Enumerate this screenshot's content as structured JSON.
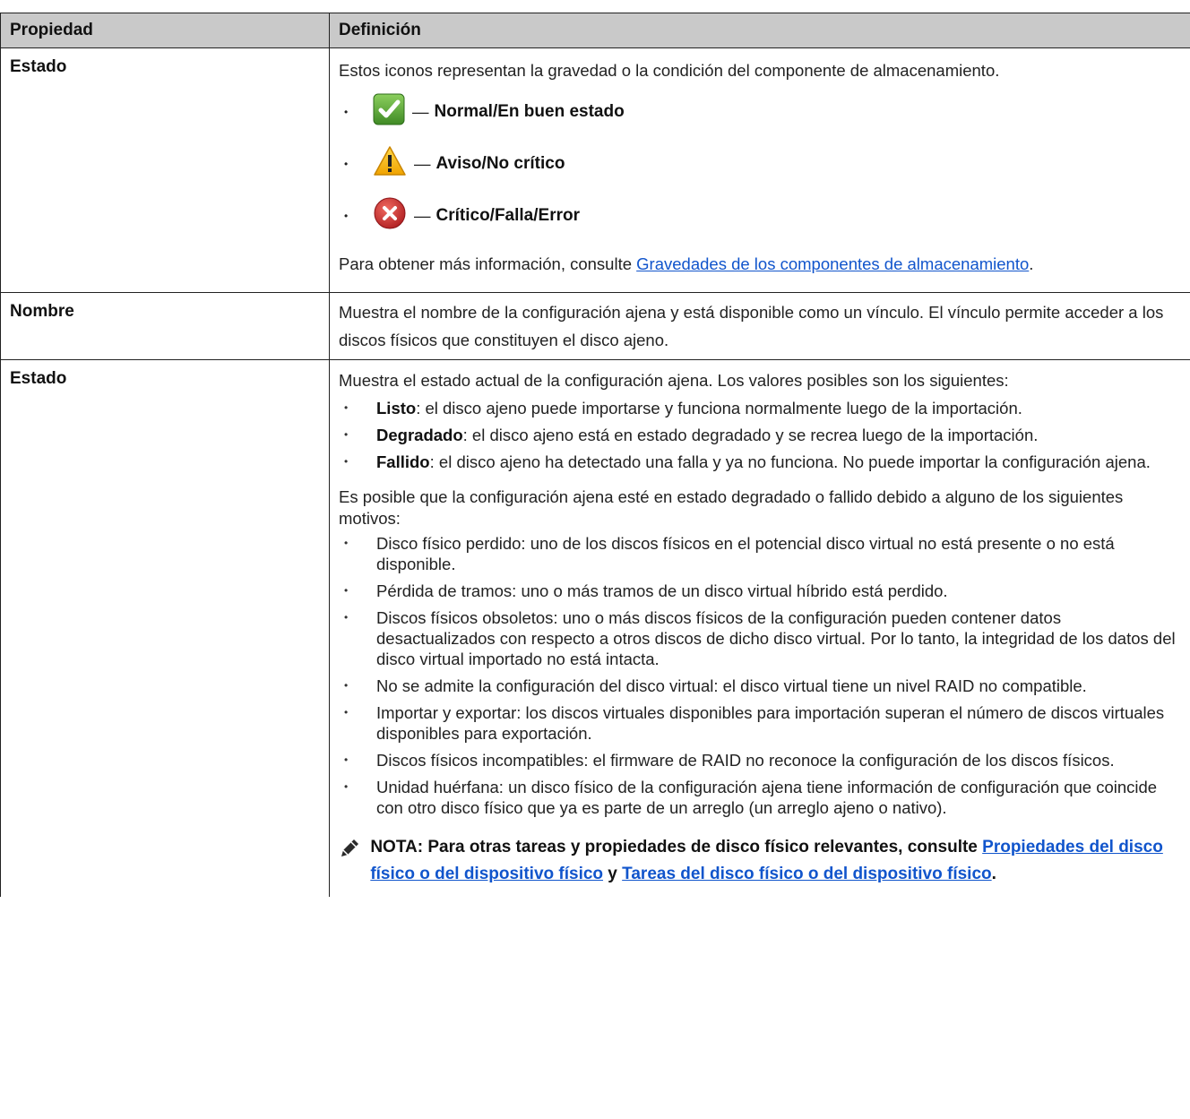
{
  "header": {
    "col1": "Propiedad",
    "col2": "Definición"
  },
  "row1": {
    "property": "Estado",
    "intro": "Estos iconos representan la gravedad o la condición del componente de almacenamiento.",
    "icons": [
      {
        "icon": "check-ok-icon",
        "label": "Normal/En buen estado",
        "color": "#5a9e3a"
      },
      {
        "icon": "warning-icon",
        "label": "Aviso/No crítico",
        "color": "#f2b600"
      },
      {
        "icon": "error-icon",
        "label": "Crítico/Falla/Error",
        "color": "#c0282b"
      }
    ],
    "dash": "—",
    "more_prefix": "Para obtener más información, consulte ",
    "more_link": "Gravedades de los componentes de almacenamiento",
    "more_suffix": "."
  },
  "row2": {
    "property": "Nombre",
    "definition": "Muestra el nombre de la configuración ajena y está disponible como un vínculo. El vínculo permite acceder a los discos físicos que constituyen el disco ajeno."
  },
  "row3": {
    "property": "Estado",
    "intro": "Muestra el estado actual de la configuración ajena. Los valores posibles son los siguientes:",
    "states": [
      {
        "term": "Listo",
        "text": ": el disco ajeno puede importarse y funciona normalmente luego de la importación."
      },
      {
        "term": "Degradado",
        "text": ": el disco ajeno está en estado degradado y se recrea luego de la importación."
      },
      {
        "term": "Fallido",
        "text": ": el disco ajeno ha detectado una falla y ya no funciona. No puede importar la configuración ajena."
      }
    ],
    "reasons_intro": "Es posible que la configuración ajena esté en estado degradado o fallido debido a alguno de los siguientes motivos:",
    "reasons": [
      "Disco físico perdido: uno de los discos físicos en el potencial disco virtual no está presente o no está disponible.",
      "Pérdida de tramos: uno o más tramos de un disco virtual híbrido está perdido.",
      "Discos físicos obsoletos: uno o más discos físicos de la configuración pueden contener datos desactualizados con respecto a otros discos de dicho disco virtual. Por lo tanto, la integridad de los datos del disco virtual importado no está intacta.",
      "No se admite la configuración del disco virtual: el disco virtual tiene un nivel RAID no compatible.",
      "Importar y exportar: los discos virtuales disponibles para importación superan el número de discos virtuales disponibles para exportación.",
      "Discos físicos incompatibles: el firmware de RAID no reconoce la configuración de los discos físicos.",
      "Unidad huérfana: un disco físico de la configuración ajena tiene información de configuración que coincide con otro disco físico que ya es parte de un arreglo (un arreglo ajeno o nativo)."
    ],
    "note_prefix": "NOTA: Para otras tareas y propiedades de disco físico relevantes, consulte ",
    "note_link1": "Propiedades del disco físico o del dispositivo físico",
    "note_mid": " y ",
    "note_link2": "Tareas del disco físico o del dispositivo físico",
    "note_suffix": "."
  }
}
